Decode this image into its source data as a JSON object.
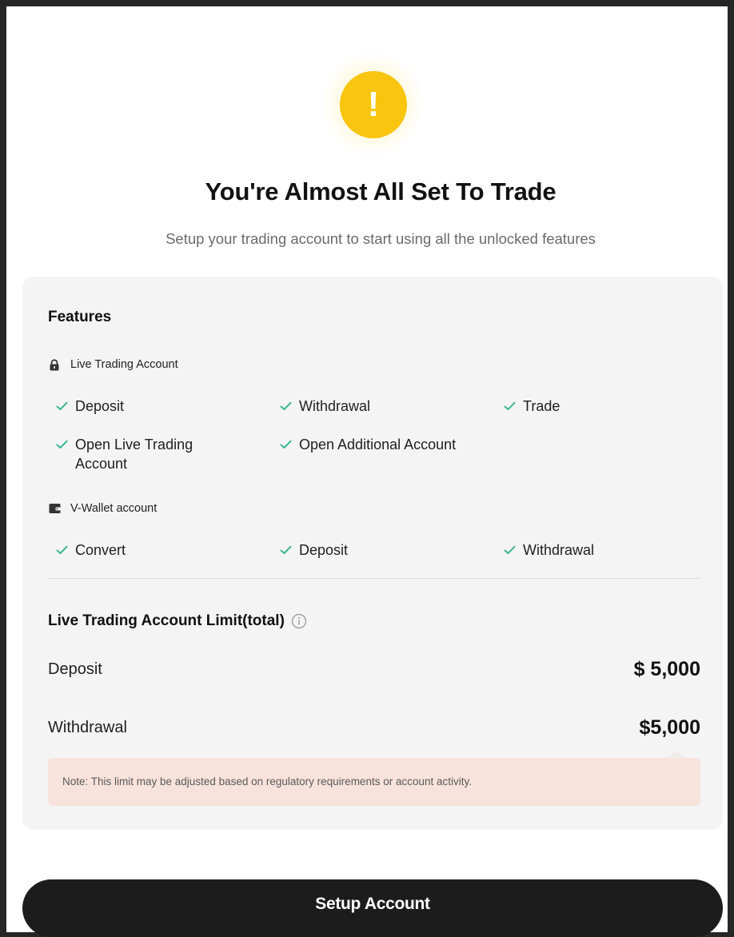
{
  "header": {
    "icon": "warning-exclamation-icon",
    "icon_glyph": "!",
    "title": "You're Almost All Set To Trade",
    "subtitle": "Setup your trading account to start using all the unlocked features"
  },
  "features": {
    "title": "Features",
    "groups": [
      {
        "title": "Live Trading Account",
        "icon": "lock-icon",
        "items": [
          "Deposit",
          "Withdrawal",
          "Trade",
          "Open Live Trading Account",
          "Open Additional Account"
        ]
      },
      {
        "title": "V-Wallet account",
        "icon": "wallet-icon",
        "items": [
          "Convert",
          "Deposit",
          "Withdrawal"
        ]
      }
    ]
  },
  "limits": {
    "title": "Live Trading Account Limit(total)",
    "rows": [
      {
        "label": "Deposit",
        "value": "$ 5,000"
      },
      {
        "label": "Withdrawal",
        "value": "$5,000"
      }
    ],
    "note": "Note: This limit may be adjusted based on regulatory requirements or account activity."
  },
  "actions": {
    "setup_label": "Setup Account"
  },
  "colors": {
    "accent_warning": "#f9c50f",
    "check_green": "#3ab795",
    "button_dark": "#1c1c1c",
    "panel_bg": "#f4f4f4",
    "note_bg": "#f7e2dc"
  }
}
